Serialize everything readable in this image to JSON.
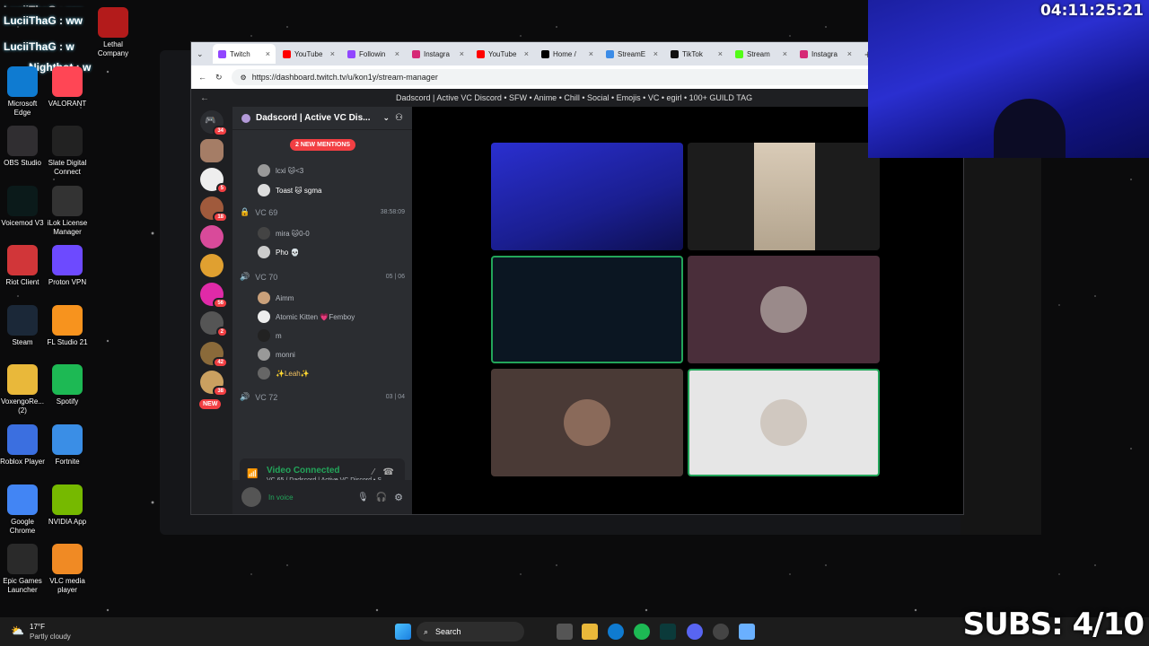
{
  "overlay": {
    "chat_lines": [
      "LuciiThaG : ww",
      "LuciiThaG : ww",
      "LuciiThaG : w",
      "Nightbot : w"
    ],
    "timer": "04:11:25:21",
    "subs": "SUBS: 4/10"
  },
  "desktop_icons": [
    {
      "label": "Lethal Company",
      "icon": "lethal-company-icon",
      "color": "#b31b1b"
    },
    {
      "label": "Microsoft Edge",
      "icon": "edge-icon",
      "color": "#0f7bd1"
    },
    {
      "label": "VALORANT",
      "icon": "valorant-icon",
      "color": "#ff4655"
    },
    {
      "label": "OBS Studio",
      "icon": "obs-icon",
      "color": "#302e31"
    },
    {
      "label": "Slate Digital Connect",
      "icon": "slate-icon",
      "color": "#222"
    },
    {
      "label": "Voicemod V3",
      "icon": "voicemod-icon",
      "color": "#0b1a1a"
    },
    {
      "label": "iLok License Manager",
      "icon": "ilok-icon",
      "color": "#333"
    },
    {
      "label": "Riot Client",
      "icon": "riot-icon",
      "color": "#d13639"
    },
    {
      "label": "Proton VPN",
      "icon": "proton-icon",
      "color": "#6d4aff"
    },
    {
      "label": "Steam",
      "icon": "steam-icon",
      "color": "#1b2838"
    },
    {
      "label": "FL Studio 21",
      "icon": "fl-studio-icon",
      "color": "#f7931e"
    },
    {
      "label": "VoxengoRe... (2)",
      "icon": "folder-icon",
      "color": "#e9b83a"
    },
    {
      "label": "Spotify",
      "icon": "spotify-icon",
      "color": "#1db954"
    },
    {
      "label": "Roblox Player",
      "icon": "roblox-icon",
      "color": "#3b6fe0"
    },
    {
      "label": "Fortnite",
      "icon": "fortnite-icon",
      "color": "#3a8ee6"
    },
    {
      "label": "Google Chrome",
      "icon": "chrome-icon",
      "color": "#4285f4"
    },
    {
      "label": "NVIDIA App",
      "icon": "nvidia-icon",
      "color": "#76b900"
    },
    {
      "label": "Epic Games Launcher",
      "icon": "epic-icon",
      "color": "#2a2a2a"
    },
    {
      "label": "VLC media player",
      "icon": "vlc-icon",
      "color": "#f08a24"
    }
  ],
  "browser": {
    "tabs": [
      {
        "label": "Twitch",
        "color": "#9146ff"
      },
      {
        "label": "YouTube",
        "color": "#ff0000"
      },
      {
        "label": "Followin",
        "color": "#9146ff"
      },
      {
        "label": "Instagra",
        "color": "#d62976"
      },
      {
        "label": "YouTube",
        "color": "#ff0000"
      },
      {
        "label": "Home /",
        "color": "#000000"
      },
      {
        "label": "StreamE",
        "color": "#3c8ce7"
      },
      {
        "label": "TikTok",
        "color": "#111111"
      },
      {
        "label": "Stream",
        "color": "#53fc18"
      },
      {
        "label": "Instagra",
        "color": "#d62976"
      }
    ],
    "url": "https://dashboard.twitch.tv/u/kon1y/stream-manager",
    "popout_title": "Dadscord | Active VC Discord • SFW • Anime • Chill • Social • Emojis • VC • egirl • 100+ GUILD TAG"
  },
  "discord": {
    "guild_badges": [
      "34",
      "5",
      "18",
      "56",
      "2",
      "42",
      "38"
    ],
    "new_label": "NEW",
    "server_name": "Dadscord | Active VC Dis...",
    "mentions_pill": "2 NEW MENTIONS",
    "users_top": [
      "lcxi 🐱<3",
      "Toast 🐱 sgma"
    ],
    "vc69": {
      "name": "VC 69",
      "time": "38:58:09",
      "users": [
        "mira 🐱0-0",
        "Pho 💀"
      ]
    },
    "vc70": {
      "name": "VC 70",
      "count_a": "05",
      "count_b": "06",
      "users": [
        "Aimm",
        "Atomic Kitten 💗Femboy",
        "m",
        "monni",
        "✨Leah✨"
      ]
    },
    "vc72": {
      "name": "VC 72",
      "count_a": "03",
      "count_b": "04"
    },
    "voice": {
      "status": "Video Connected",
      "channel": "VC 65 / Dadscord | Active VC Discord • S..."
    },
    "user_status": "In voice"
  },
  "taskbar": {
    "weather_temp": "17°F",
    "weather_desc": "Partly cloudy",
    "search": "Search"
  }
}
